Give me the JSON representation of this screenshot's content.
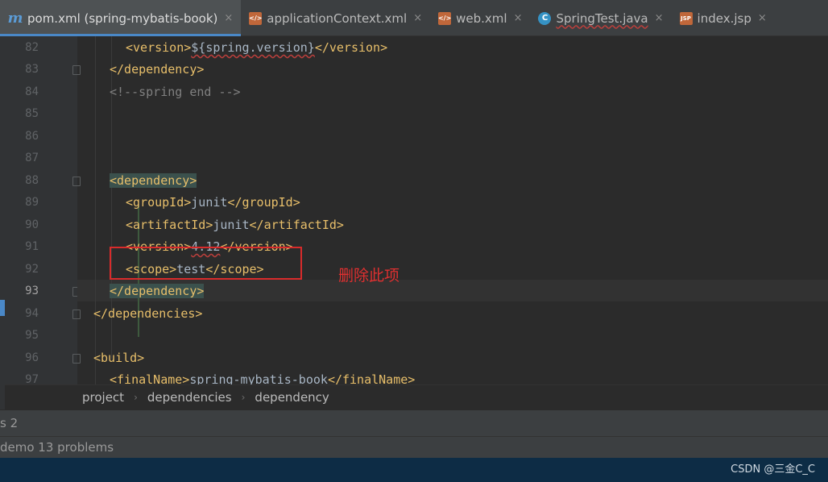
{
  "tabs": [
    {
      "label": "pom.xml (spring-mybatis-book)",
      "icon": "maven-icon",
      "active": true
    },
    {
      "label": "applicationContext.xml",
      "icon": "xml-file-icon",
      "active": false
    },
    {
      "label": "web.xml",
      "icon": "xml-file-icon",
      "active": false
    },
    {
      "label": "SpringTest.java",
      "icon": "java-class-icon",
      "active": false
    },
    {
      "label": "index.jsp",
      "icon": "jsp-file-icon",
      "active": false
    }
  ],
  "tab_icon_text": {
    "xml": "</>",
    "java": "C",
    "jsp": "JSP",
    "maven": "m"
  },
  "close_glyph": "×",
  "line_numbers": [
    "82",
    "83",
    "84",
    "85",
    "86",
    "87",
    "88",
    "89",
    "90",
    "91",
    "92",
    "93",
    "94",
    "95",
    "96",
    "97"
  ],
  "code": {
    "l82": {
      "open": "<version>",
      "text": "${spring.version}",
      "close": "</version>"
    },
    "l83": {
      "close": "</dependency>"
    },
    "l84": {
      "comment": "<!--spring end -->"
    },
    "l88": {
      "open": "<dependency>"
    },
    "l89": {
      "open": "<groupId>",
      "text": "junit",
      "close": "</groupId>"
    },
    "l90": {
      "open": "<artifactId>",
      "text": "junit",
      "close": "</artifactId>"
    },
    "l91": {
      "open": "<version>",
      "text": "4.12",
      "close": "</version>"
    },
    "l92": {
      "open": "<scope>",
      "text": "test",
      "close": "</scope>"
    },
    "l93": {
      "close": "</dependency>"
    },
    "l94": {
      "close": "</dependencies>"
    },
    "l96": {
      "open": "<build>"
    },
    "l97": {
      "open": "<finalName>",
      "text": "spring-mybatis-book",
      "close": "</finalName>"
    }
  },
  "annotation": {
    "note": "删除此项",
    "color": "#e03030"
  },
  "breadcrumb": [
    "project",
    "dependencies",
    "dependency"
  ],
  "breadcrumb_sep": "›",
  "panels": {
    "problems_tab": "s 2",
    "problems_summary": "demo  13 problems"
  },
  "status": {
    "watermark": "CSDN @三金C_C"
  },
  "colors": {
    "tag": "#e8bf6a",
    "text": "#a9b7c6",
    "comment": "#808080",
    "accent": "#4a88c7"
  }
}
